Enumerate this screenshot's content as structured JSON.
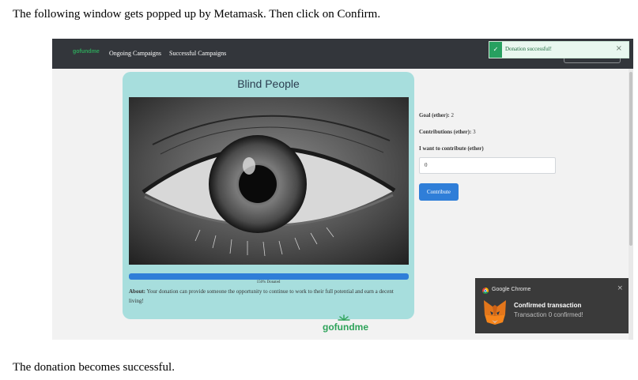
{
  "instructions": {
    "before": "The following window gets popped up by Metamask. Then click on Confirm.",
    "after": "The donation becomes successful."
  },
  "navbar": {
    "logo": "gofundme",
    "links": [
      "Ongoing Campaigns",
      "Successful Campaigns"
    ]
  },
  "toast": {
    "message": "Donation successful!",
    "close": "×"
  },
  "campaign": {
    "title": "Blind People",
    "progress_label": "150% Donated",
    "progress_fraction": 1.0,
    "about_label": "About:",
    "about_text": "Your donation can provide someone the opportunity to continue to work to their full potential and earn a decent living!",
    "goal_label": "Goal (ether):",
    "goal_value": "2",
    "contrib_label": "Contributions (ether):",
    "contrib_value": "3",
    "contribute_label": "I want to contribute (ether)",
    "amount_value": "0",
    "contribute_button": "Contribute"
  },
  "footer_logo": "gofundme",
  "notification": {
    "app": "Google Chrome",
    "close": "×",
    "title": "Confirmed transaction",
    "body": "Transaction 0 confirmed!"
  },
  "colors": {
    "navbar": "#33363b",
    "card": "#a7dedd",
    "accent": "#2f7ed8",
    "brand": "#2ea35a",
    "toast_bg": "#e9f7ef"
  }
}
